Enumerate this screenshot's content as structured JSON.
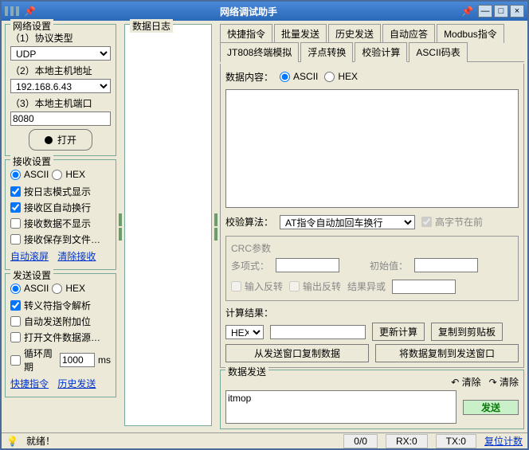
{
  "title": "网络调试助手",
  "left": {
    "net_group": "网络设置",
    "proto_label": "（1）协议类型",
    "proto_value": "UDP",
    "host_label": "（2）本地主机地址",
    "host_value": "192.168.6.43",
    "port_label": "（3）本地主机端口",
    "port_value": "8080",
    "open_btn": "打开",
    "recv_group": "接收设置",
    "recv_ascii": "ASCII",
    "recv_hex": "HEX",
    "recv_opt1": "按日志模式显示",
    "recv_opt2": "接收区自动换行",
    "recv_opt3": "接收数据不显示",
    "recv_opt4": "接收保存到文件…",
    "recv_link1": "自动滚屏",
    "recv_link2": "清除接收",
    "send_group": "发送设置",
    "send_ascii": "ASCII",
    "send_hex": "HEX",
    "send_opt1": "转义符指令解析",
    "send_opt2": "自动发送附加位",
    "send_opt3": "打开文件数据源…",
    "send_opt4": "循环周期",
    "send_period": "1000",
    "send_ms": "ms",
    "send_link1": "快捷指令",
    "send_link2": "历史发送"
  },
  "mid": {
    "log_title": "数据日志"
  },
  "right": {
    "tabs": [
      "快捷指令",
      "批量发送",
      "历史发送",
      "自动应答",
      "Modbus指令",
      "JT808终端模拟",
      "浮点转换",
      "校验计算",
      "ASCII码表"
    ],
    "data_label": "数据内容：",
    "ascii": "ASCII",
    "hex": "HEX",
    "algo_label": "校验算法：",
    "algo_value": "AT指令自动加回车换行",
    "highbyte": "高字节在前",
    "crc_title": "CRC参数",
    "poly": "多项式：",
    "init": "初始值：",
    "in_rev": "输入反转",
    "out_rev": "输出反转",
    "xor": "结果异或",
    "result_label": "计算结果：",
    "result_fmt": "HEX",
    "result_value": "",
    "btn_calc": "更新计算",
    "btn_copy": "复制到剪贴板",
    "btn_copyfrom": "从发送窗口复制数据",
    "btn_copyto": "将数据复制到发送窗口"
  },
  "send": {
    "group": "数据发送",
    "clear1": "清除",
    "clear2": "清除",
    "value": "itmop",
    "btn": "发送"
  },
  "status": {
    "ready": "就绪！",
    "io": "0/0",
    "rx": "RX:0",
    "tx": "TX:0",
    "reset": "复位计数"
  }
}
